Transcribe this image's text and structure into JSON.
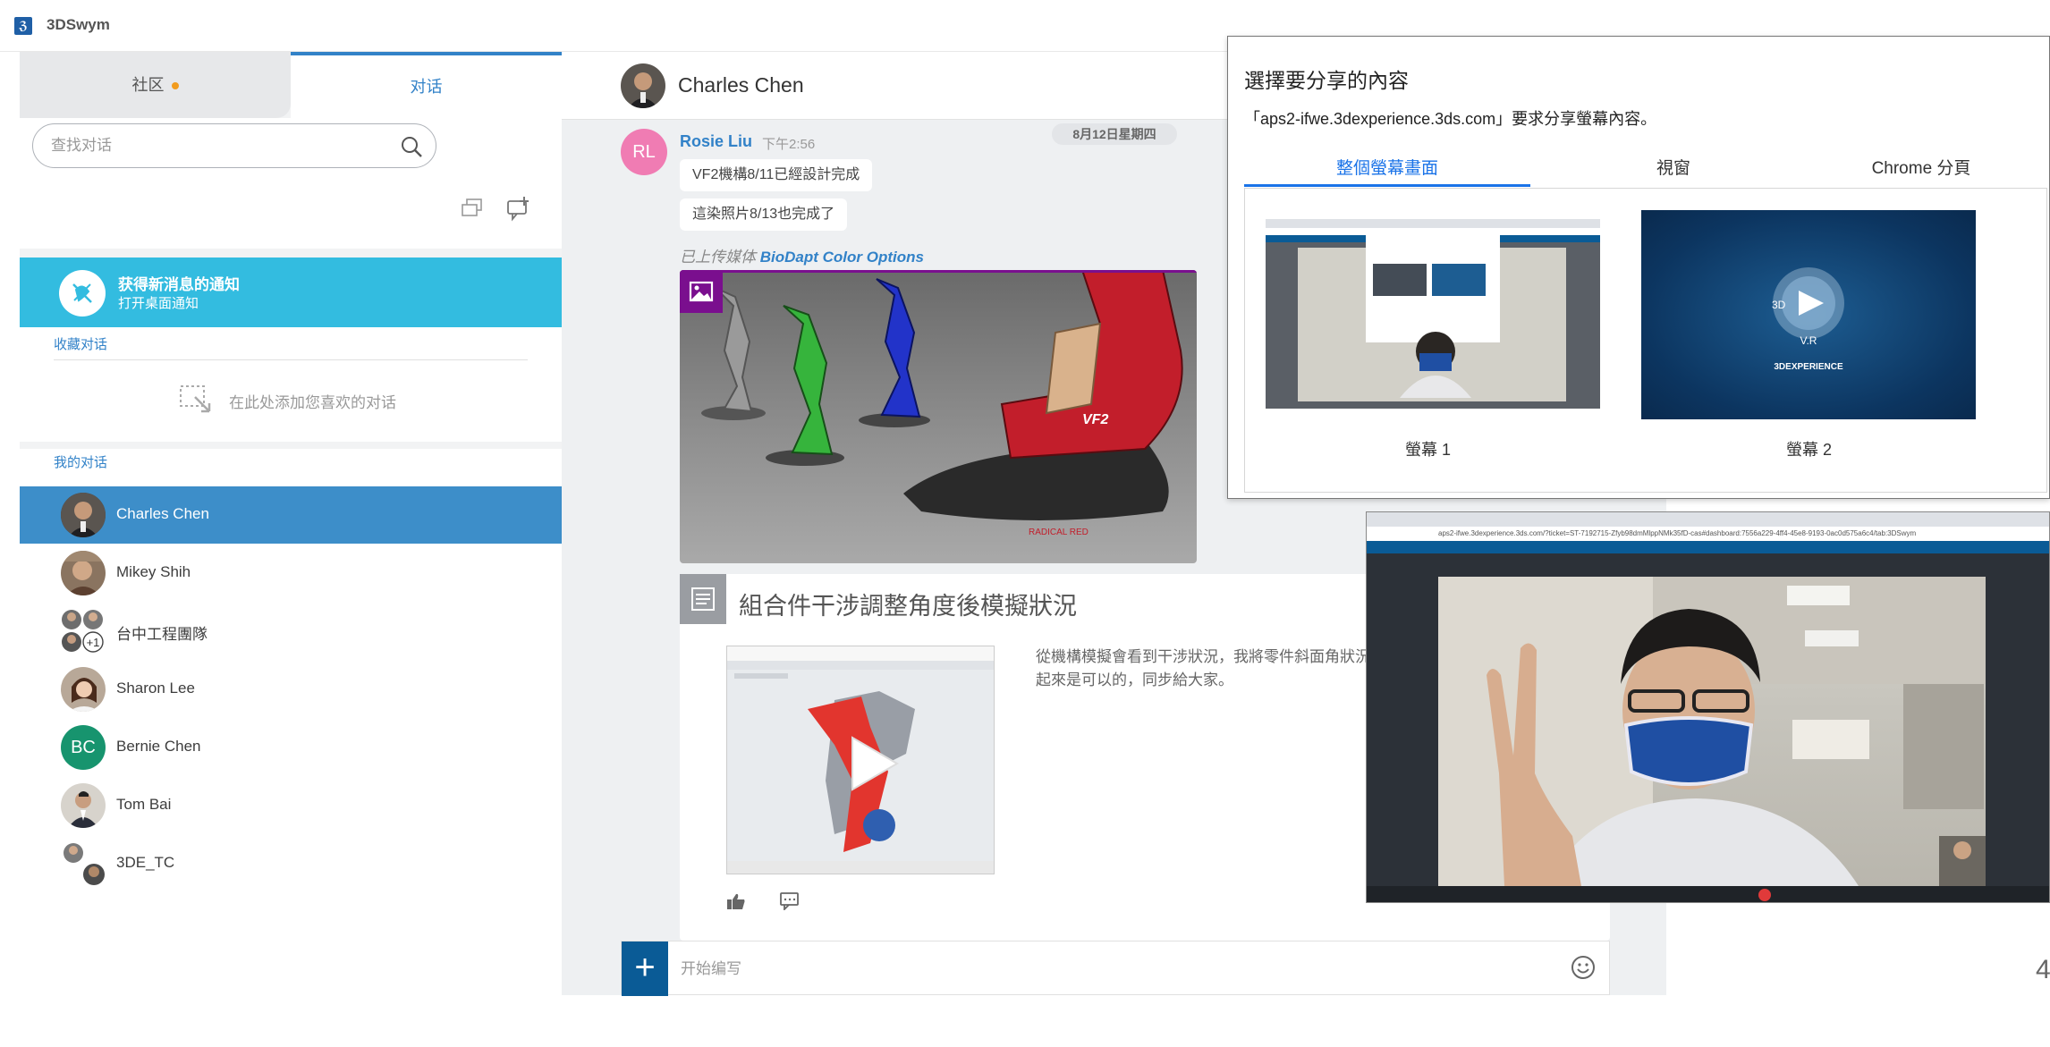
{
  "app": {
    "name": "3DSwym",
    "logo_text": "ℨ"
  },
  "sidebar": {
    "tabs": [
      {
        "label": "社区"
      },
      {
        "label": "对话"
      }
    ],
    "search": {
      "placeholder": "查找对话"
    },
    "notification": {
      "title": "获得新消息的通知",
      "subtitle": "打开桌面通知"
    },
    "favorites": {
      "title": "收藏对话",
      "empty_text": "在此处添加您喜欢的对话"
    },
    "my_conversations": {
      "title": "我的对话",
      "items": [
        {
          "name": "Charles Chen"
        },
        {
          "name": "Mikey Shih"
        },
        {
          "name": "台中工程團隊",
          "badge": "+1"
        },
        {
          "name": "Sharon Lee"
        },
        {
          "name": "Bernie Chen",
          "initials": "BC"
        },
        {
          "name": "Tom Bai"
        },
        {
          "name": "3DE_TC"
        }
      ]
    }
  },
  "chat": {
    "header": {
      "name": "Charles Chen"
    },
    "date_chip": "8月12日星期四",
    "message": {
      "sender": "Rosie Liu",
      "sender_initials": "RL",
      "time": "下午2:56",
      "lines": [
        "VF2機構8/11已經設計完成",
        "這染照片8/13也完成了"
      ],
      "upload_prefix": "已上传媒体",
      "upload_name": "BioDapt Color Options",
      "image_labels": {
        "model": "VF2",
        "variant": "RADICAL RED"
      }
    },
    "post": {
      "title": "組合件干涉調整角度後模擬狀況",
      "text": "從機構模擬會看到干涉狀況，我將零件斜面角狀況看起來是可以的，同步給大家。"
    },
    "composer": {
      "placeholder": "开始编写"
    }
  },
  "share_dialog": {
    "title": "選擇要分享的內容",
    "description": "「aps2-ifwe.3dexperience.3ds.com」要求分享螢幕內容。",
    "tabs": [
      {
        "label": "整個螢幕畫面"
      },
      {
        "label": "視窗"
      },
      {
        "label": "Chrome 分頁"
      }
    ],
    "screens": [
      {
        "label": "螢幕 1"
      },
      {
        "label": "螢幕 2"
      }
    ],
    "screen2_brand": "3DEXPERIENCE",
    "screen2_logo": "V.R"
  },
  "video_window": {
    "url": "aps2-ifwe.3dexperience.3ds.com/?ticket=ST-7192715-Zfyb98dmMlppNMk35fD-cas#dashboard:7556a229-4ff4-45e8-9193-0ac0d575a6c4/tab:3DSwym"
  },
  "page_number": "4",
  "colors": {
    "accent": "#3282c8",
    "notify": "#33bce0",
    "active_item": "#3d8ec9",
    "composer_plus": "#0a5b96",
    "community_dot": "#f29c1f"
  }
}
